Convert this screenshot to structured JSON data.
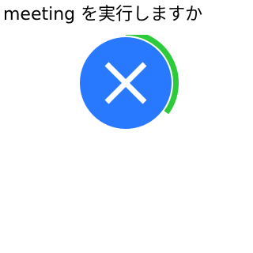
{
  "dialog": {
    "prompt_text": "meeting を実行しますか",
    "cancel_button": {
      "icon": "close-icon",
      "color": "#2979FF",
      "icon_color": "#ffffff"
    },
    "countdown": {
      "progress": 0.35,
      "color": "#2DCB3C"
    }
  }
}
